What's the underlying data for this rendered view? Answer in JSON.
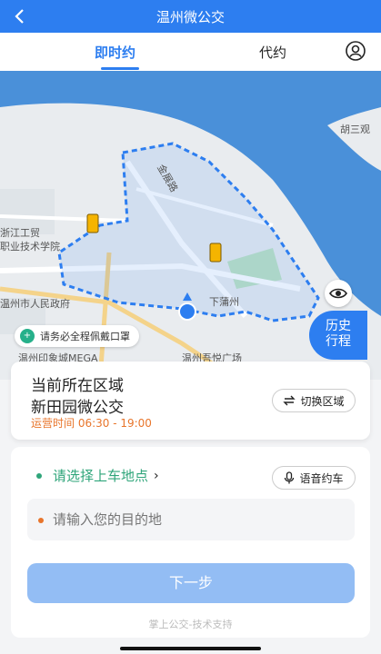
{
  "header": {
    "back_icon": "chevron-left-icon",
    "title": "温州微公交"
  },
  "tabs": [
    {
      "label": "即时约",
      "active": true
    },
    {
      "label": "代约",
      "active": false
    }
  ],
  "map": {
    "labels": {
      "hu_san": "胡三观",
      "zhejiang_1": "浙江工贸",
      "zhejiang_2": "职业技术学院",
      "gov": "温州市人民政府",
      "jin_zhan": "金展路",
      "xia_pu": "下蒲州",
      "plaza": "温州吾悦广场",
      "mall": "温州印象城MEGA"
    },
    "mask_notice": "请务必全程佩戴口罩",
    "history_button": [
      "历史",
      "行程"
    ],
    "accent": "#2d7ef0"
  },
  "area_card": {
    "line1": "当前所在区域",
    "line2": "新田园微公交",
    "hours": "运营时间 06:30 - 19:00",
    "switch_label": "切换区域"
  },
  "booking": {
    "pickup_label": "请选择上车地点",
    "voice_label": "语音约车",
    "destination_placeholder": "请输入您的目的地",
    "next_label": "下一步",
    "footer": "掌上公交-技术支持"
  }
}
